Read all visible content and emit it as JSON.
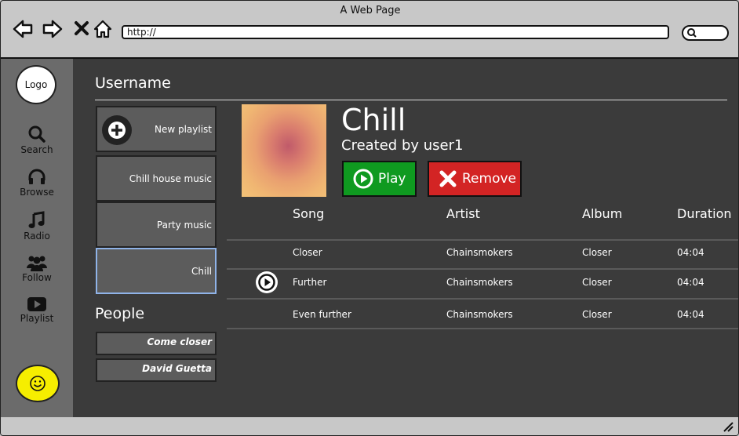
{
  "window": {
    "title": "A Web Page"
  },
  "browser": {
    "url": "http://"
  },
  "sidebar": {
    "logo": "Logo",
    "items": [
      {
        "label": "Search",
        "icon": "search-icon"
      },
      {
        "label": "Browse",
        "icon": "headphones-icon"
      },
      {
        "label": "Radio",
        "icon": "music-note-icon"
      },
      {
        "label": "Follow",
        "icon": "people-icon"
      },
      {
        "label": "Playlist",
        "icon": "video-play-icon"
      }
    ]
  },
  "header": {
    "username": "Username"
  },
  "playlists": [
    {
      "label": "New playlist"
    },
    {
      "label": "Chill house music"
    },
    {
      "label": "Party music"
    },
    {
      "label": "Chill"
    }
  ],
  "people": {
    "title": "People",
    "items": [
      {
        "label": "Come closer"
      },
      {
        "label": "David Guetta"
      }
    ]
  },
  "playlist_view": {
    "title": "Chill",
    "subtitle": "Created by user1",
    "play_label": "Play",
    "remove_label": "Remove"
  },
  "table": {
    "headers": {
      "song": "Song",
      "artist": "Artist",
      "album": "Album",
      "duration": "Duration"
    },
    "rows": [
      {
        "song": "Closer",
        "artist": "Chainsmokers",
        "album": "Closer",
        "duration": "04:04"
      },
      {
        "song": "Further",
        "artist": "Chainsmokers",
        "album": "Closer",
        "duration": "04:04"
      },
      {
        "song": "Even further",
        "artist": "Chainsmokers",
        "album": "Closer",
        "duration": "04:04"
      }
    ]
  },
  "colors": {
    "play": "#0f9a20",
    "remove": "#d32424",
    "accent": "#f6ee00",
    "selected_border": "#8fb3e8"
  }
}
